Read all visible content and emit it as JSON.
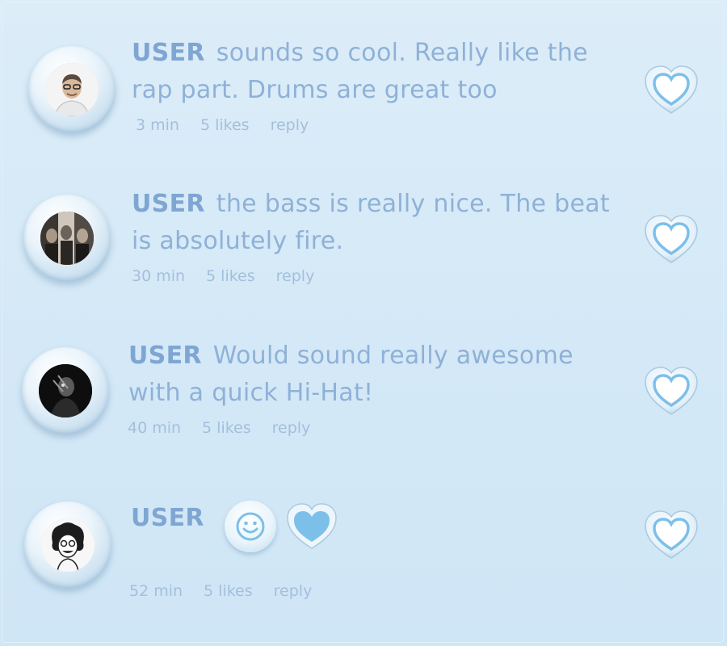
{
  "comments": [
    {
      "user": "USER",
      "line1": "sounds so cool. Really like the",
      "line2": "rap part. Drums are great too",
      "time": "3 min",
      "likes": "5 likes",
      "reply": "reply",
      "avatar": "smiling-man-glasses"
    },
    {
      "user": "USER",
      "line1": "the bass is really nice. The beat",
      "line2": "is absolutely fire.",
      "time": "30 min",
      "likes": "5 likes",
      "reply": "reply",
      "avatar": "band-photo"
    },
    {
      "user": "USER",
      "line1": "Would sound really awesome",
      "line2": "with a quick Hi-Hat!",
      "time": "40 min",
      "likes": "5 likes",
      "reply": "reply",
      "avatar": "dark-portrait"
    },
    {
      "user": "USER",
      "time": "52 min",
      "likes": "5 likes",
      "reply": "reply",
      "avatar": "curly-hair-sketch",
      "reactions": [
        "smiley-icon",
        "heart-filled-icon"
      ]
    }
  ],
  "icons": {
    "like": "heart-outline-icon",
    "smiley": "smiley-icon",
    "heart_filled": "heart-filled-icon"
  },
  "colors": {
    "background": "#d8ebf8",
    "username": "#7fa6d3",
    "text": "#8fb1d7",
    "meta": "#a3bfdc",
    "heart": "#7cc0ea"
  }
}
